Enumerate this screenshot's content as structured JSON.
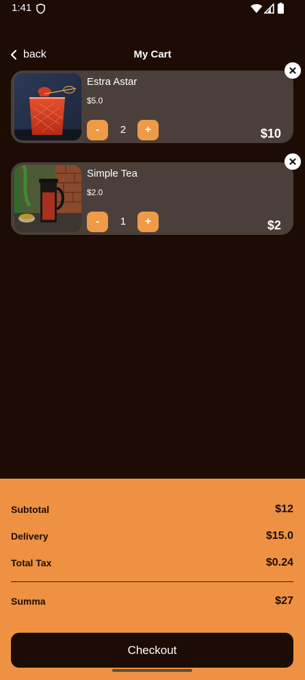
{
  "status_bar": {
    "time": "1:41"
  },
  "header": {
    "back_label": "back",
    "title": "My Cart"
  },
  "cart": {
    "items": [
      {
        "name": "Estra Astar",
        "price": "$5.0",
        "quantity": "2",
        "total": "$10",
        "minus_label": "-",
        "plus_label": "+",
        "image": "red-cocktail-photo"
      },
      {
        "name": "Simple Tea",
        "price": "$2.0",
        "quantity": "1",
        "total": "$2",
        "minus_label": "-",
        "plus_label": "+",
        "image": "tea-press-photo"
      }
    ]
  },
  "summary": {
    "subtotal_label": "Subtotal",
    "subtotal_value": "$12",
    "delivery_label": "Delivery",
    "delivery_value": "$15.0",
    "tax_label": "Total Tax",
    "tax_value": "$0.24",
    "total_label": "Summa",
    "total_value": "$27"
  },
  "checkout": {
    "label": "Checkout"
  },
  "colors": {
    "background": "#1c0c03",
    "card": "#4a3f3a",
    "accent": "#ee9a46",
    "summary_panel": "#ee9142"
  }
}
